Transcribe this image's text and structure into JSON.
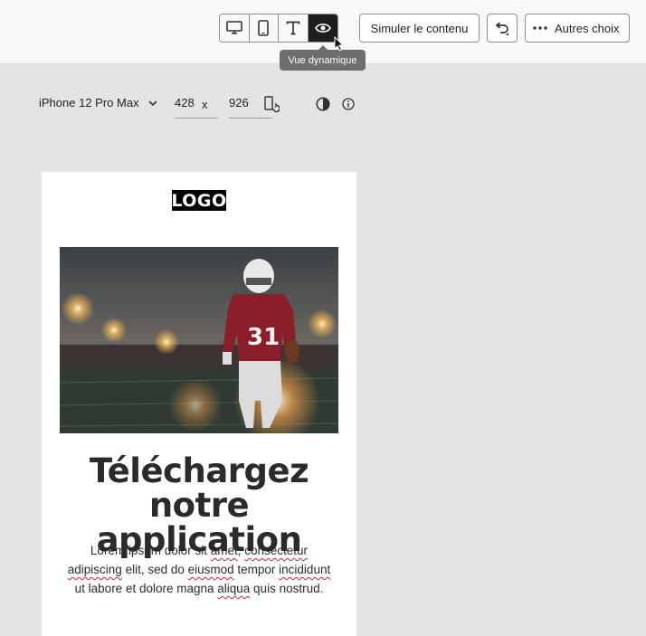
{
  "toolbar": {
    "view_buttons": [
      {
        "name": "desktop",
        "icon": "desktop-icon"
      },
      {
        "name": "mobile",
        "icon": "mobile-icon"
      },
      {
        "name": "text",
        "icon": "text-icon"
      },
      {
        "name": "dynamic",
        "icon": "eye-icon",
        "active": true
      }
    ],
    "tooltip": "Vue dynamique",
    "simulate_label": "Simuler le contenu",
    "undo_icon": "undo-icon",
    "more_label": "Autres choix",
    "more_icon": "more-icon"
  },
  "device": {
    "name": "iPhone 12 Pro Max",
    "width": "428",
    "separator": "x",
    "height": "926",
    "rotate_icon": "rotate-device-icon",
    "contrast_icon": "contrast-icon",
    "info_icon": "info-icon"
  },
  "email": {
    "logo": "LOGO",
    "headline_line1": "Téléchargez",
    "headline_line2": "notre application",
    "body": {
      "w1": "Lorem ipsum dolor sit ",
      "w2": "amet",
      "w3": ", ",
      "w4": "consectetur",
      "w5": "adipiscing",
      "w6": " elit, sed do ",
      "w7": "eiusmod",
      "w8": " tempor ",
      "w9": "incididunt",
      "w10": "ut labore et dolore magna ",
      "w11": "aliqua",
      "w12": " quis nostrud."
    }
  },
  "colors": {
    "active_button": "#1d1d1d",
    "tooltip_bg": "#6e6e6e",
    "canvas_bg": "#e4e4e4"
  }
}
